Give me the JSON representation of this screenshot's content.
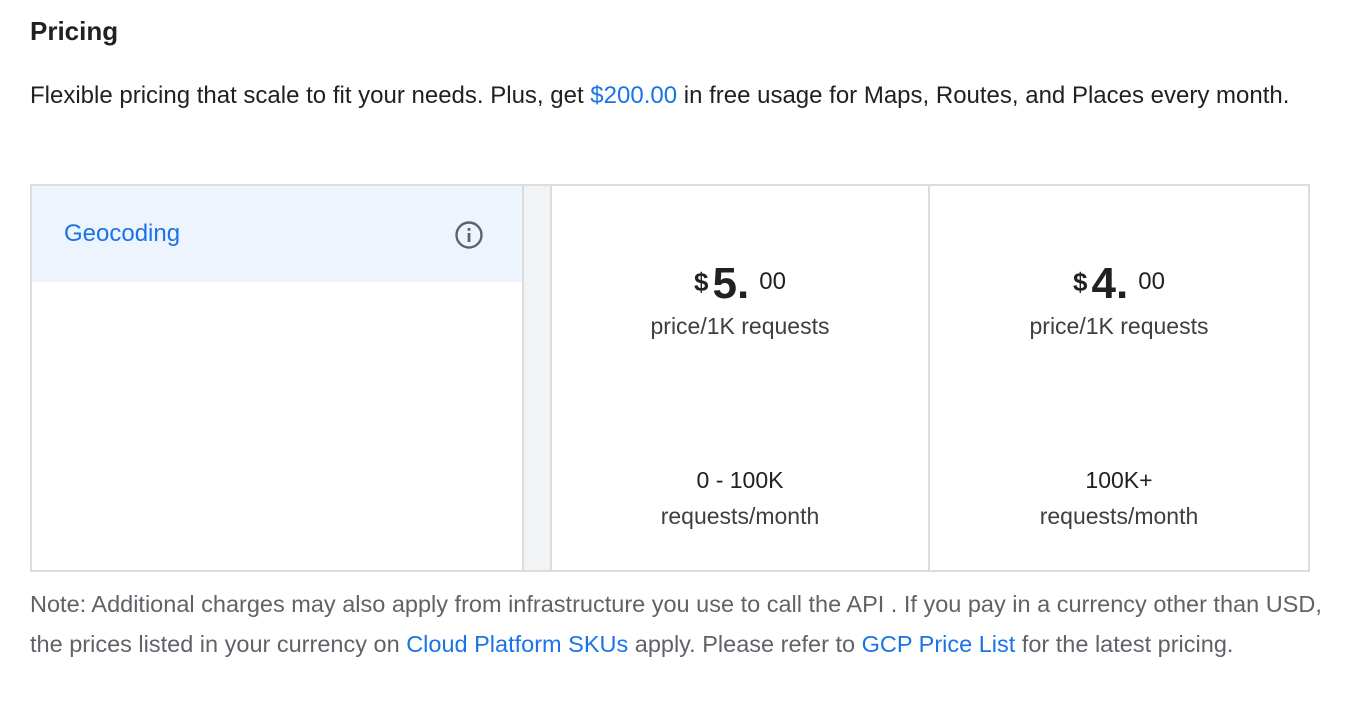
{
  "pricing": {
    "title": "Pricing",
    "intro": {
      "before": "Flexible pricing that scale to fit your needs. Plus, get ",
      "amount_link": "$200.00",
      "after": " in free usage for Maps, Routes, and Places every month."
    },
    "sku": {
      "label": "Geocoding",
      "icon": "info-icon"
    },
    "tiers": [
      {
        "currency": "$",
        "whole": "5",
        "dot": ".",
        "cents": "00",
        "unit": "price/1K requests",
        "range": "0 - 100K",
        "range_unit": "requests/month"
      },
      {
        "currency": "$",
        "whole": "4",
        "dot": ".",
        "cents": "00",
        "unit": "price/1K requests",
        "range": "100K+",
        "range_unit": "requests/month"
      }
    ],
    "note": {
      "part1": "Note: Additional charges may also apply from infrastructure you use to call the API . If you pay in a currency other than USD, the prices listed in your currency on ",
      "link1": "Cloud Platform SKUs",
      "part2": " apply. Please refer to ",
      "link2": "GCP Price List",
      "part3": " for the latest pricing."
    },
    "colors": {
      "link": "#1a73e8",
      "selected_row_bg": "#eef4fd",
      "border": "#dadce0",
      "text": "#202124",
      "muted_text": "#5f6368"
    }
  }
}
